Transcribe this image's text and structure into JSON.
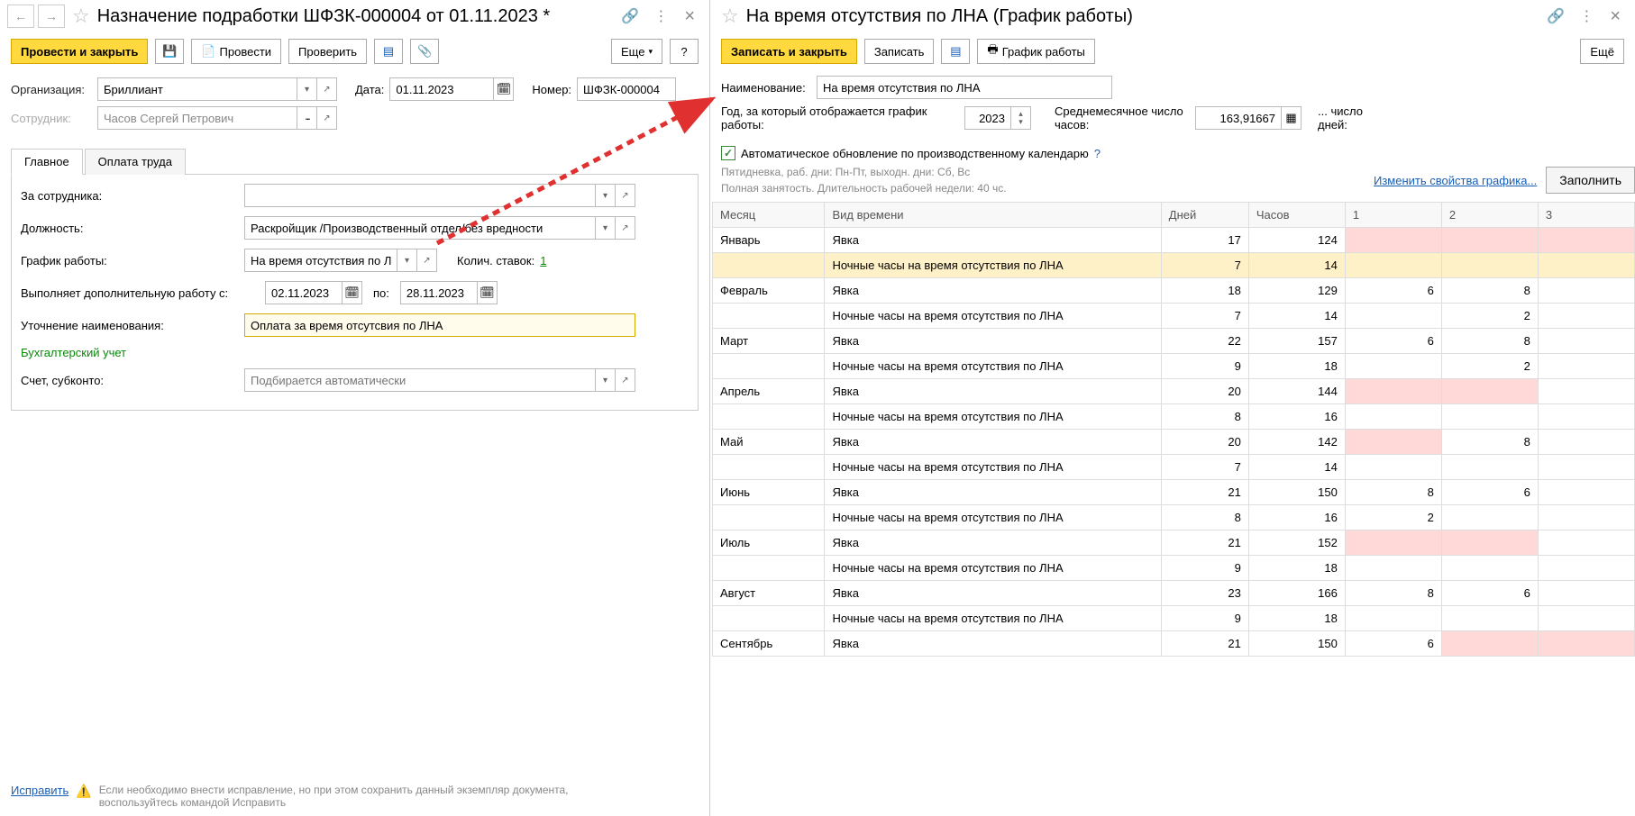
{
  "left": {
    "title": "Назначение подработки ШФЗК-000004 от 01.11.2023 *",
    "toolbar": {
      "post_close": "Провести и закрыть",
      "post": "Провести",
      "check": "Проверить",
      "more": "Еще",
      "help": "?"
    },
    "org_label": "Организация:",
    "org_value": "Бриллиант",
    "date_label": "Дата:",
    "date_value": "01.11.2023",
    "number_label": "Номер:",
    "number_value": "ШФЗК-000004",
    "employee_label": "Сотрудник:",
    "employee_value": "Часов Сергей Петрович",
    "tabs": {
      "main": "Главное",
      "pay": "Оплата труда"
    },
    "for_employee_label": "За сотрудника:",
    "position_label": "Должность:",
    "position_value": "Раскройщик /Производственный отдел/без вредности",
    "schedule_label": "График работы:",
    "schedule_value": "На время отсутствия по ЛНА",
    "rates_label": "Колич. ставок:",
    "rates_value": "1",
    "extra_from_label": "Выполняет дополнительную работу с:",
    "extra_from": "02.11.2023",
    "to_label": "по:",
    "extra_to": "28.11.2023",
    "clarify_label": "Уточнение наименования:",
    "clarify_value": "Оплата за время отсутсвия по ЛНА",
    "bookkeeping_label": "Бухгалтерский учет",
    "account_label": "Счет, субконто:",
    "account_placeholder": "Подбирается автоматически",
    "footer_fix": "Исправить",
    "footer_msg": "Если необходимо внести исправление, но при этом сохранить данный экземпляр документа, воспользуйтесь командой Исправить"
  },
  "right": {
    "title": "На время отсутствия по ЛНА (График работы)",
    "toolbar": {
      "save_close": "Записать и закрыть",
      "save": "Записать",
      "schedule": "График работы",
      "more": "Ещё"
    },
    "name_label": "Наименование:",
    "name_value": "На время отсутствия по ЛНА",
    "year_label": "Год, за который отображается график работы:",
    "year_value": "2023",
    "avghours_label": "Среднемесячное число часов:",
    "avghours_value": "163,91667",
    "days_label": "... число дней:",
    "autoupdate_label": "Автоматическое обновление по производственному календарю",
    "info1": "Пятидневка, раб. дни: Пн-Пт, выходн. дни: Сб, Вс",
    "info2": "Полная занятость. Длительность рабочей недели: 40 чс.",
    "change_link": "Изменить свойства графика...",
    "fill_btn": "Заполнить",
    "cols": {
      "month": "Месяц",
      "type": "Вид времени",
      "days": "Дней",
      "hours": "Часов",
      "c1": "1",
      "c2": "2",
      "c3": "3"
    },
    "type_attend": "Явка",
    "type_night": "Ночные часы на время отсутствия по ЛНА",
    "rows": [
      {
        "month": "Январь",
        "type_key": "attend",
        "days": 17,
        "hours": 124,
        "c1": "",
        "c2": "",
        "c3": "",
        "pink": [
          1,
          2,
          3
        ],
        "hl": false,
        "month_start": true
      },
      {
        "month": "",
        "type_key": "night",
        "days": 7,
        "hours": 14,
        "c1": "",
        "c2": "",
        "c3": "",
        "pink": [],
        "hl": true,
        "month_start": false
      },
      {
        "month": "Февраль",
        "type_key": "attend",
        "days": 18,
        "hours": 129,
        "c1": "6",
        "c2": "8",
        "c3": "",
        "pink": [],
        "hl": false,
        "month_start": true
      },
      {
        "month": "",
        "type_key": "night",
        "days": 7,
        "hours": 14,
        "c1": "",
        "c2": "2",
        "c3": "",
        "pink": [],
        "hl": false,
        "month_start": false
      },
      {
        "month": "Март",
        "type_key": "attend",
        "days": 22,
        "hours": 157,
        "c1": "6",
        "c2": "8",
        "c3": "",
        "pink": [],
        "hl": false,
        "month_start": true
      },
      {
        "month": "",
        "type_key": "night",
        "days": 9,
        "hours": 18,
        "c1": "",
        "c2": "2",
        "c3": "",
        "pink": [],
        "hl": false,
        "month_start": false
      },
      {
        "month": "Апрель",
        "type_key": "attend",
        "days": 20,
        "hours": 144,
        "c1": "",
        "c2": "",
        "c3": "",
        "pink": [
          1,
          2
        ],
        "hl": false,
        "month_start": true
      },
      {
        "month": "",
        "type_key": "night",
        "days": 8,
        "hours": 16,
        "c1": "",
        "c2": "",
        "c3": "",
        "pink": [],
        "hl": false,
        "month_start": false
      },
      {
        "month": "Май",
        "type_key": "attend",
        "days": 20,
        "hours": 142,
        "c1": "",
        "c2": "8",
        "c3": "",
        "pink": [
          1
        ],
        "hl": false,
        "month_start": true
      },
      {
        "month": "",
        "type_key": "night",
        "days": 7,
        "hours": 14,
        "c1": "",
        "c2": "",
        "c3": "",
        "pink": [],
        "hl": false,
        "month_start": false
      },
      {
        "month": "Июнь",
        "type_key": "attend",
        "days": 21,
        "hours": 150,
        "c1": "8",
        "c2": "6",
        "c3": "",
        "pink": [],
        "hl": false,
        "month_start": true
      },
      {
        "month": "",
        "type_key": "night",
        "days": 8,
        "hours": 16,
        "c1": "2",
        "c2": "",
        "c3": "",
        "pink": [],
        "hl": false,
        "month_start": false
      },
      {
        "month": "Июль",
        "type_key": "attend",
        "days": 21,
        "hours": 152,
        "c1": "",
        "c2": "",
        "c3": "",
        "pink": [
          1,
          2
        ],
        "hl": false,
        "month_start": true
      },
      {
        "month": "",
        "type_key": "night",
        "days": 9,
        "hours": 18,
        "c1": "",
        "c2": "",
        "c3": "",
        "pink": [],
        "hl": false,
        "month_start": false
      },
      {
        "month": "Август",
        "type_key": "attend",
        "days": 23,
        "hours": 166,
        "c1": "8",
        "c2": "6",
        "c3": "",
        "pink": [],
        "hl": false,
        "month_start": true
      },
      {
        "month": "",
        "type_key": "night",
        "days": 9,
        "hours": 18,
        "c1": "",
        "c2": "",
        "c3": "",
        "pink": [],
        "hl": false,
        "month_start": false
      },
      {
        "month": "Сентябрь",
        "type_key": "attend",
        "days": 21,
        "hours": 150,
        "c1": "6",
        "c2": "",
        "c3": "",
        "pink": [
          2,
          3
        ],
        "hl": false,
        "month_start": true
      }
    ]
  }
}
